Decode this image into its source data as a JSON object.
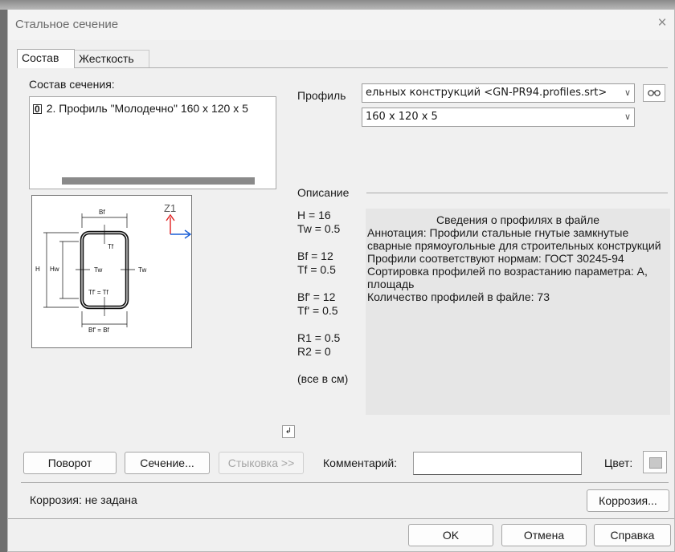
{
  "window": {
    "title": "Стальное сечение",
    "close_glyph": "×"
  },
  "tabs": [
    {
      "label": "Состав"
    },
    {
      "label": "Жесткость"
    }
  ],
  "section": {
    "label": "Состав сечения:",
    "items": [
      {
        "marker": "0",
        "label": "2. Профиль \"Молодечно\" 160 х 120 х 5"
      }
    ]
  },
  "profile": {
    "label": "Профиль",
    "library": "ельных конструкций <GN-PR94.profiles.srt>",
    "size": "160 x 120 x 5",
    "view_icon": "glasses-icon"
  },
  "diagram": {
    "axis_label": "Z1",
    "labels": {
      "bf": "Bf",
      "tf": "Tf",
      "h": "H",
      "hw": "Hw",
      "tw_left": "Tw",
      "tw_right": "Tw",
      "tf2": "Tf' = Tf",
      "bf2": "Bf' = Bf"
    }
  },
  "description": {
    "label": "Описание",
    "params": [
      "H = 16",
      "Tw = 0.5",
      "",
      "Bf = 12",
      "Tf = 0.5",
      "",
      "Bf' = 12",
      "Tf' = 0.5",
      "",
      "R1 = 0.5",
      "R2 = 0",
      "",
      "(все в см)"
    ]
  },
  "info": {
    "heading": "Сведения о профилях в файле",
    "lines": [
      "Аннотация: Профили стальные гнутые замкнутые сварные прямоугольные для строительных конструкций",
      "Профили соответствуют нормам: ГОСТ 30245-94",
      "Сортировка профилей по возрастанию параметра: А, площадь",
      "Количество профилей в файле: 73"
    ]
  },
  "buttons": {
    "rotate": "Поворот",
    "section": "Сечение...",
    "joint": "Стыковка >>",
    "comment_label": "Комментарий:",
    "comment_value": "",
    "color_label": "Цвет:",
    "corrosion_status": "Коррозия:  не задана",
    "corrosion": "Коррозия...",
    "ok": "OK",
    "cancel": "Отмена",
    "help": "Справка"
  },
  "colors": {
    "accent_red": "#e02020",
    "accent_blue": "#1a5fd6",
    "dialog_bg": "#f0f0f0",
    "info_bg": "#e6e6e6"
  }
}
